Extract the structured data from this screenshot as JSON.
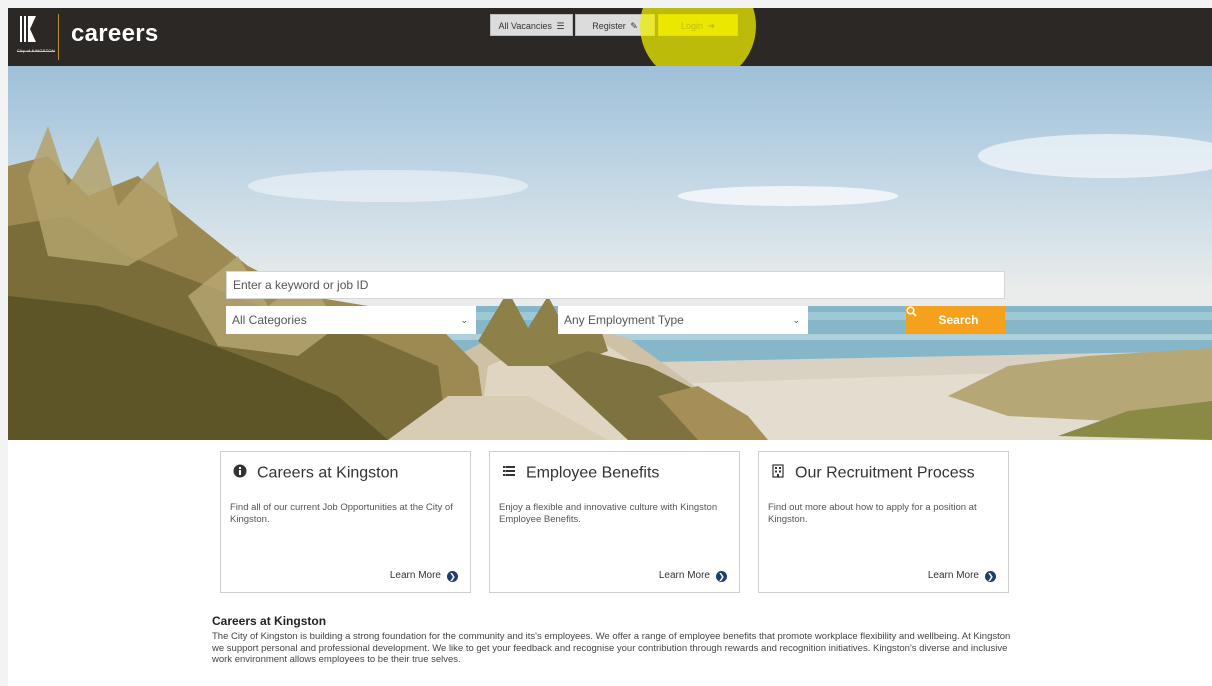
{
  "header": {
    "brand": "careers",
    "logo_text": "City of KINGSTON",
    "nav": {
      "vacancies_label": "All Vacancies",
      "register_label": "Register",
      "login_label": "Login"
    }
  },
  "search": {
    "keyword_placeholder": "Enter a keyword or job ID",
    "category_selected": "All Categories",
    "employment_selected": "Any Employment Type",
    "button_label": "Search"
  },
  "cards": [
    {
      "icon": "info-circle-icon",
      "title": "Careers at Kingston",
      "description": "Find all of our current Job Opportunities at the City of Kingston.",
      "link": "Learn More"
    },
    {
      "icon": "list-icon",
      "title": "Employee Benefits",
      "description": "Enjoy a flexible and innovative culture with Kingston Employee Benefits.",
      "link": "Learn More"
    },
    {
      "icon": "building-icon",
      "title": "Our Recruitment Process",
      "description": "Find out more about how to apply for a position at Kingston.",
      "link": "Learn More"
    }
  ],
  "intro": {
    "title": "Careers at Kingston",
    "text": "The City of Kingston is building a strong foundation for the community and its's employees.  We offer a range of employee benefits that promote workplace flexibility and wellbeing. At Kingston we support personal and professional development. We like to get your feedback and recognise your contribution through rewards and recognition initiatives. Kingston's diverse and inclusive work environment allows employees to be their true selves."
  },
  "colors": {
    "header_bg": "#2b2826",
    "accent_orange": "#f6a11e",
    "login_yellow": "#e3d800",
    "link_icon_navy": "#1f3e6e"
  }
}
